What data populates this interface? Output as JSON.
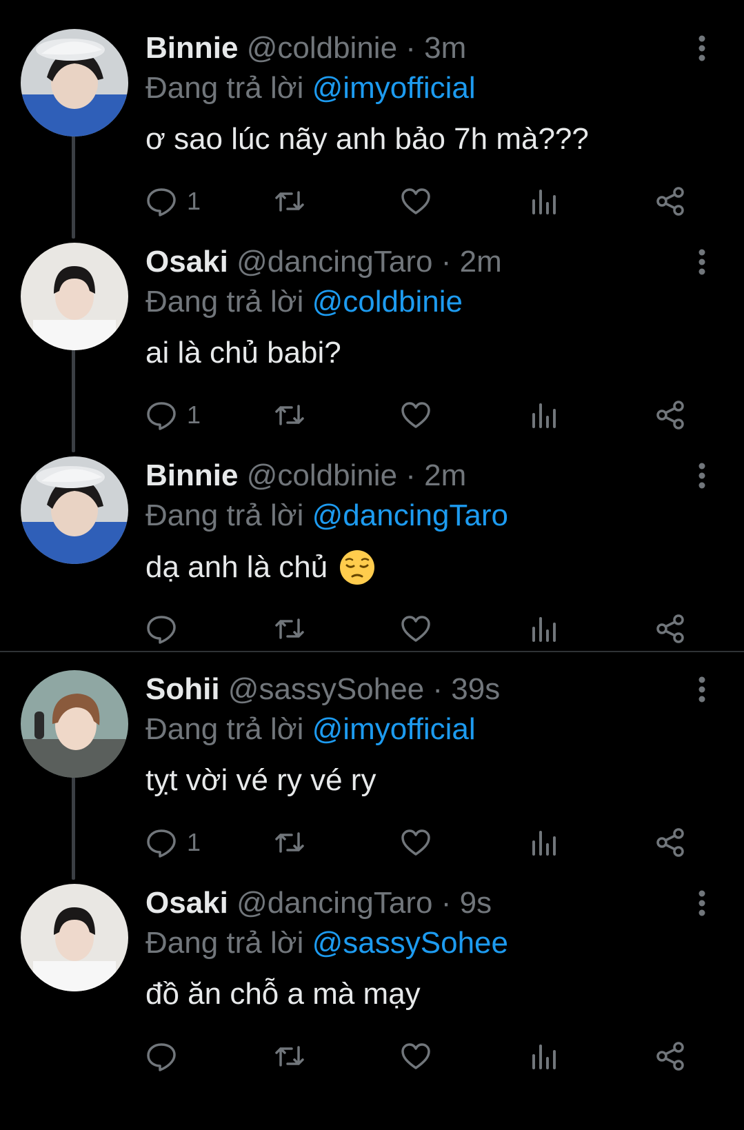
{
  "reply_prefix": "Đang trả lời",
  "colors": {
    "background": "#000000",
    "text": "#e7e9ea",
    "muted": "#71767b",
    "mention": "#1d9bf0",
    "thread_line": "#3b3f44"
  },
  "icons": [
    "reply-icon",
    "retweet-icon",
    "like-icon",
    "views-icon",
    "share-icon",
    "more-icon",
    "pensive-face-emoji"
  ],
  "tweets": [
    {
      "display_name": "Binnie",
      "handle": "@coldbinie",
      "time": "· 3m",
      "reply_to": "@imyofficial",
      "text": "ơ sao lúc nãy anh bảo 7h mà???",
      "reply_count": "1",
      "emoji": ""
    },
    {
      "display_name": "Osaki",
      "handle": "@dancingTaro",
      "time": "· 2m",
      "reply_to": "@coldbinie",
      "text": "ai là chủ babi?",
      "reply_count": "1",
      "emoji": ""
    },
    {
      "display_name": "Binnie",
      "handle": "@coldbinie",
      "time": "· 2m",
      "reply_to": "@dancingTaro",
      "text": "dạ anh là chủ",
      "reply_count": "",
      "emoji": "pensive-face"
    },
    {
      "display_name": "Sohii",
      "handle": "@sassySohee",
      "time": "· 39s",
      "reply_to": "@imyofficial",
      "text": "tỵt vời vé ry vé ry",
      "reply_count": "1",
      "emoji": ""
    },
    {
      "display_name": "Osaki",
      "handle": "@dancingTaro",
      "time": "· 9s",
      "reply_to": "@sassySohee",
      "text": "đồ ăn chỗ a mà mạy",
      "reply_count": "",
      "emoji": ""
    }
  ]
}
